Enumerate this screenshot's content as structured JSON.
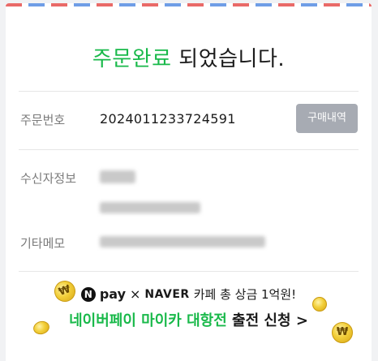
{
  "header": {
    "title_highlight": "주문완료",
    "title_rest": " 되었습니다."
  },
  "order": {
    "number_label": "주문번호",
    "number_value": "2024011233724591",
    "history_button": "구매내역"
  },
  "recipient": {
    "label": "수신자정보"
  },
  "memo": {
    "label": "기타메모"
  },
  "promo": {
    "badge_letter": "N",
    "pay_text": "pay",
    "times": "×",
    "naver_text": "NAVER",
    "line1_text": "카페 총 상금 1억원!",
    "line2_highlight": "네이버페이 마이카 대항전",
    "line2_rest": " 출전 신청 >"
  },
  "colors": {
    "accent_green": "#19b94a",
    "button_gray": "#a7abb3"
  }
}
